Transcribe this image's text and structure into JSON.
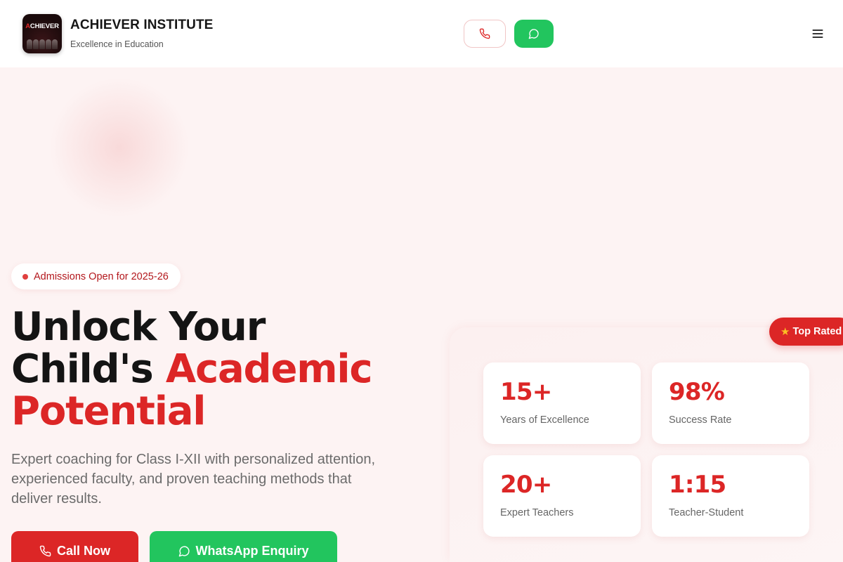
{
  "header": {
    "logo_text": "ACHIEVER",
    "brand_title": "ACHIEVER INSTITUTE",
    "brand_subtitle": "Excellence in Education",
    "phone_icon": "phone-icon",
    "whatsapp_icon": "chat-bubble-icon",
    "menu_icon": "hamburger-menu-icon"
  },
  "hero": {
    "badge": "Admissions Open for 2025-26",
    "headline_line1": "Unlock Your",
    "headline_line2_plain": "Child's ",
    "headline_line2_accent": "Academic",
    "headline_line3_accent": "Potential",
    "lead": "Expert coaching for Class I-XII with personalized attention, experienced faculty, and proven teaching methods that deliver results.",
    "cta_call": "Call Now",
    "cta_whatsapp": "WhatsApp Enquiry"
  },
  "stats": [
    {
      "value": "15+",
      "label": "Years of Excellence"
    },
    {
      "value": "98%",
      "label": "Success Rate"
    },
    {
      "value": "20+",
      "label": "Expert Teachers"
    },
    {
      "value": "1:15",
      "label": "Teacher-Student"
    }
  ],
  "floating_badge": {
    "icon": "star-icon",
    "label": "Top Rated"
  },
  "colors": {
    "accent_red": "#dc2626",
    "whatsapp_green": "#22c55e",
    "background": "#fdf3f3"
  }
}
